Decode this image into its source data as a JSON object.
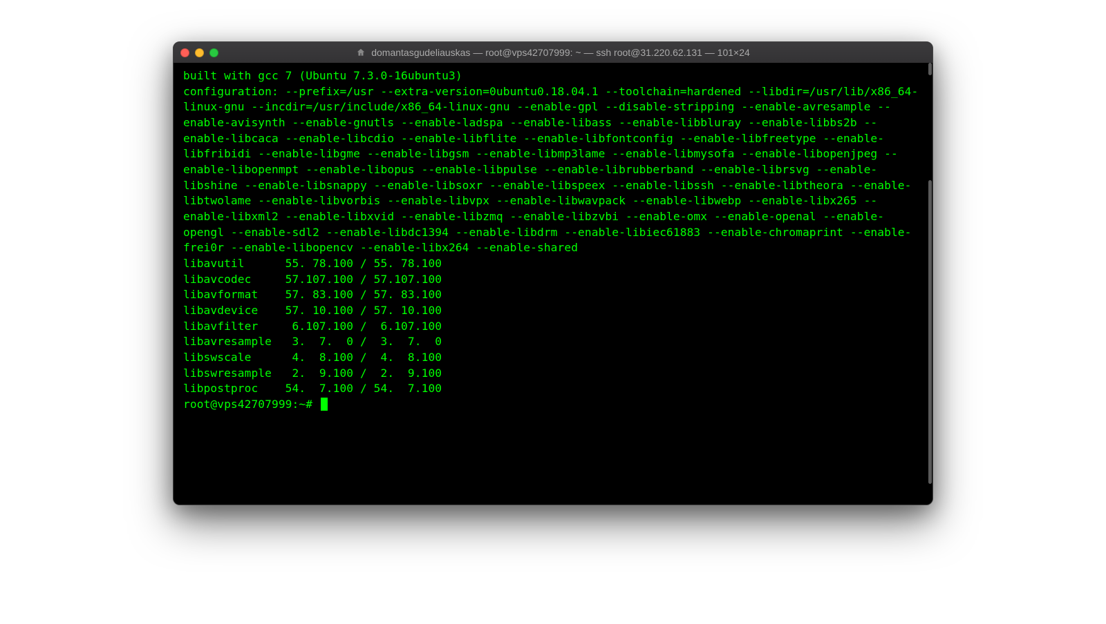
{
  "window": {
    "title": "domantasgudeliauskas — root@vps42707999: ~ — ssh root@31.220.62.131 — 101×24"
  },
  "terminal": {
    "line_built": "built with gcc 7 (Ubuntu 7.3.0-16ubuntu3)",
    "config_block": "configuration: --prefix=/usr --extra-version=0ubuntu0.18.04.1 --toolchain=hardened --libdir=/usr/lib/x86_64-linux-gnu --incdir=/usr/include/x86_64-linux-gnu --enable-gpl --disable-stripping --enable-avresample --enable-avisynth --enable-gnutls --enable-ladspa --enable-libass --enable-libbluray --enable-libbs2b --enable-libcaca --enable-libcdio --enable-libflite --enable-libfontconfig --enable-libfreetype --enable-libfribidi --enable-libgme --enable-libgsm --enable-libmp3lame --enable-libmysofa --enable-libopenjpeg --enable-libopenmpt --enable-libopus --enable-libpulse --enable-librubberband --enable-librsvg --enable-libshine --enable-libsnappy --enable-libsoxr --enable-libspeex --enable-libssh --enable-libtheora --enable-libtwolame --enable-libvorbis --enable-libvpx --enable-libwavpack --enable-libwebp --enable-libx265 --enable-libxml2 --enable-libxvid --enable-libzmq --enable-libzvbi --enable-omx --enable-openal --enable-opengl --enable-sdl2 --enable-libdc1394 --enable-libdrm --enable-libiec61883 --enable-chromaprint --enable-frei0r --enable-libopencv --enable-libx264 --enable-shared",
    "libs": [
      "libavutil      55. 78.100 / 55. 78.100",
      "libavcodec     57.107.100 / 57.107.100",
      "libavformat    57. 83.100 / 57. 83.100",
      "libavdevice    57. 10.100 / 57. 10.100",
      "libavfilter     6.107.100 /  6.107.100",
      "libavresample   3.  7.  0 /  3.  7.  0",
      "libswscale      4.  8.100 /  4.  8.100",
      "libswresample   2.  9.100 /  2.  9.100",
      "libpostproc    54.  7.100 / 54.  7.100"
    ],
    "prompt": "root@vps42707999:~# "
  }
}
